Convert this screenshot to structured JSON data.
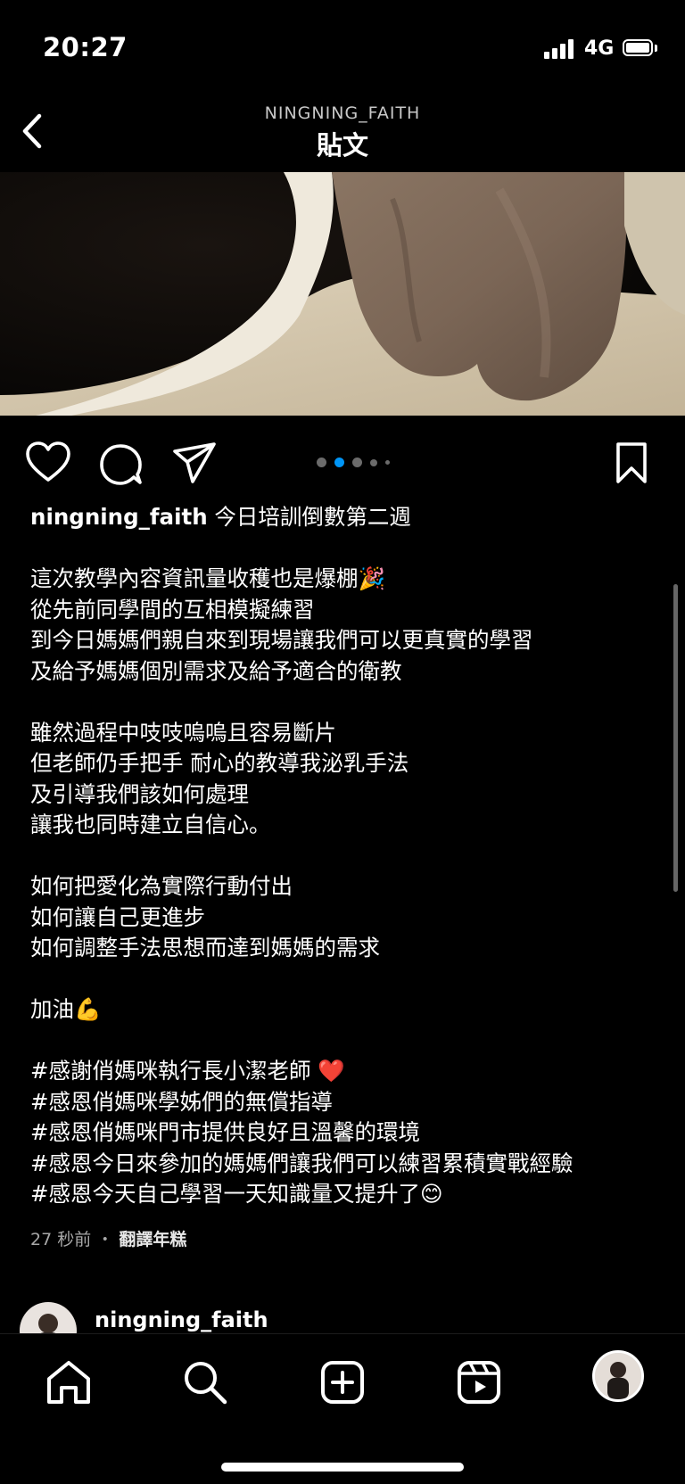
{
  "status": {
    "time": "20:27",
    "network": "4G"
  },
  "header": {
    "username": "NINGNING_FAITH",
    "title": "貼文"
  },
  "post": {
    "carousel": {
      "total": 5,
      "active_index": 1
    },
    "caption": {
      "username": "ningning_faith",
      "first_line": " 今日培訓倒數第二週",
      "lines": [
        "",
        "這次教學內容資訊量收穫也是爆棚🎉",
        "從先前同學間的互相模擬練習",
        "到今日媽媽們親自來到現場讓我們可以更真實的學習",
        "及給予媽媽個別需求及給予適合的衛教",
        "",
        "雖然過程中吱吱嗚嗚且容易斷片",
        "但老師仍手把手 耐心的教導我泌乳手法",
        "及引導我們該如何處理",
        "讓我也同時建立自信心。",
        "",
        "如何把愛化為實際行動付出",
        "如何讓自己更進步",
        "如何調整手法思想而達到媽媽的需求",
        "",
        "加油💪",
        "",
        "#感謝俏媽咪執行長小潔老師 ❤️",
        "#感恩俏媽咪學姊們的無償指導",
        "#感恩俏媽咪門市提供良好且溫馨的環境",
        "#感恩今日來參加的媽媽們讓我們可以練習累積實戰經驗",
        "#感恩今天自己學習一天知識量又提升了😊"
      ]
    },
    "time_ago": "27 秒前",
    "separator": "・",
    "translate_label": "翻譯年糕"
  },
  "comment_preview": {
    "username": "ningning_faith",
    "more": "•••"
  },
  "icons": {
    "back": "chevron-left-icon",
    "like": "heart-icon",
    "comment": "comment-icon",
    "share": "send-icon",
    "save": "bookmark-icon",
    "home": "home-icon",
    "search": "search-icon",
    "create": "plus-square-icon",
    "reels": "reels-icon"
  },
  "colors": {
    "background": "#000000",
    "text": "#ffffff",
    "active_dot": "#0095f6",
    "inactive_dot": "#6b6b6b"
  }
}
